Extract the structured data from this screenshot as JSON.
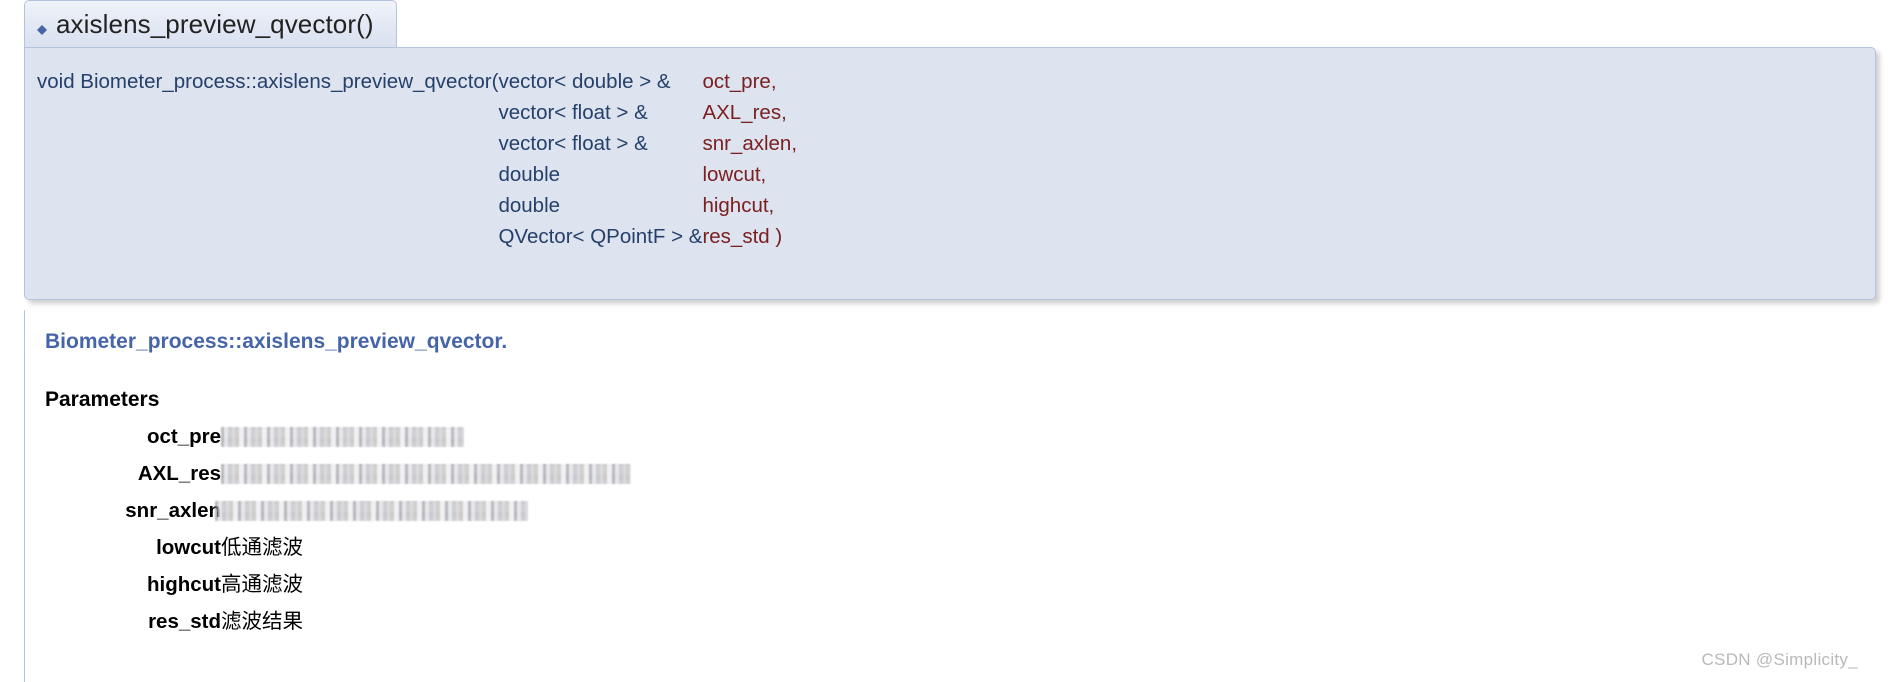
{
  "tab": {
    "title": "axislens_preview_qvector()",
    "bullet_icon": "diamond-bullet-icon"
  },
  "signature": {
    "return_and_name": "void Biometer_process::axislens_preview_qvector",
    "open_paren": "(",
    "close_paren": ")",
    "params": [
      {
        "type": "vector< double > &",
        "name": "oct_pre,"
      },
      {
        "type": "vector< float > &",
        "name": "AXL_res,"
      },
      {
        "type": "vector< float > &",
        "name": "snr_axlen,"
      },
      {
        "type": "double",
        "name": "lowcut,"
      },
      {
        "type": "double",
        "name": "highcut,"
      },
      {
        "type": "QVector< QPointF > &",
        "name": "res_std )"
      }
    ]
  },
  "body": {
    "description_link": "Biometer_process::axislens_preview_qvector",
    "description_suffix": ".",
    "parameters_heading": "Parameters",
    "parameters": [
      {
        "name": "oct_pre",
        "desc": "",
        "redacted": true,
        "redacted_class": "w1"
      },
      {
        "name": "AXL_res",
        "desc": "",
        "redacted": true,
        "redacted_class": "w2"
      },
      {
        "name": "snr_axlen",
        "desc": "",
        "redacted": true,
        "redacted_class": "w3"
      },
      {
        "name": "lowcut",
        "desc": "低通滤波",
        "redacted": false
      },
      {
        "name": "highcut",
        "desc": "高通滤波",
        "redacted": false
      },
      {
        "name": "res_std",
        "desc": "滤波结果",
        "redacted": false
      }
    ]
  },
  "watermark": "CSDN @Simplicity_",
  "colors": {
    "proto_background": "#dde3ef",
    "proto_border": "#b5c4de",
    "type_text": "#25406b",
    "param_name_text": "#7a2020",
    "link_text": "#4665a8",
    "watermark_text": "#b9b9b9"
  }
}
